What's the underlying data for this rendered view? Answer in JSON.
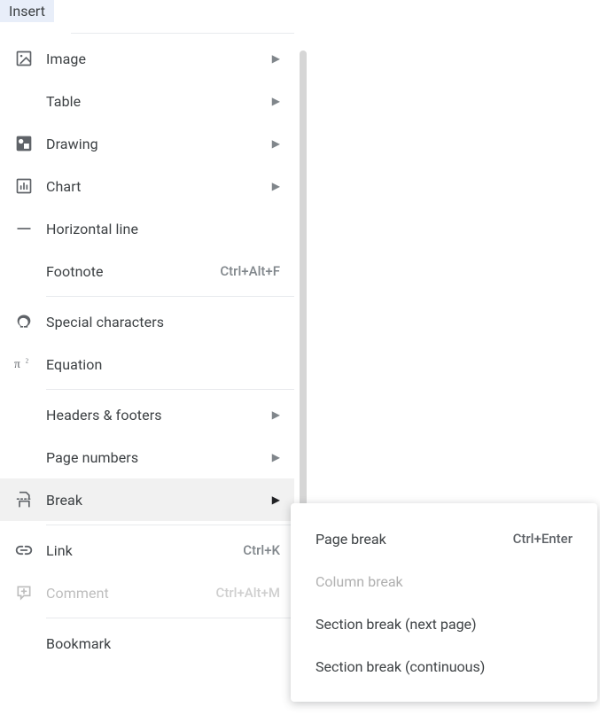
{
  "menuTitle": "Insert",
  "items": {
    "image": {
      "label": "Image"
    },
    "table": {
      "label": "Table"
    },
    "drawing": {
      "label": "Drawing"
    },
    "chart": {
      "label": "Chart"
    },
    "hline": {
      "label": "Horizontal line"
    },
    "footnote": {
      "label": "Footnote",
      "shortcut": "Ctrl+Alt+F"
    },
    "special": {
      "label": "Special characters"
    },
    "equation": {
      "label": "Equation"
    },
    "headers": {
      "label": "Headers & footers"
    },
    "pagenum": {
      "label": "Page numbers"
    },
    "break": {
      "label": "Break"
    },
    "link": {
      "label": "Link",
      "shortcut": "Ctrl+K"
    },
    "comment": {
      "label": "Comment",
      "shortcut": "Ctrl+Alt+M"
    },
    "bookmark": {
      "label": "Bookmark"
    }
  },
  "submenu": {
    "pagebreak": {
      "label": "Page break",
      "shortcut": "Ctrl+Enter"
    },
    "columnbreak": {
      "label": "Column break"
    },
    "sectionnext": {
      "label": "Section break (next page)"
    },
    "sectioncont": {
      "label": "Section break (continuous)"
    }
  }
}
